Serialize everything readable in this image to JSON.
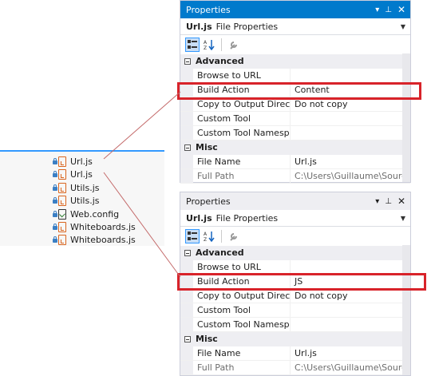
{
  "solution": {
    "items": [
      {
        "label": "Url.js",
        "icon": "js-file-icon"
      },
      {
        "label": "Url.js",
        "icon": "js-file-icon"
      },
      {
        "label": "Utils.js",
        "icon": "js-file-icon"
      },
      {
        "label": "Utils.js",
        "icon": "js-file-icon"
      },
      {
        "label": "Web.config",
        "icon": "config-file-icon"
      },
      {
        "label": "Whiteboards.js",
        "icon": "js-file-icon"
      },
      {
        "label": "Whiteboards.js",
        "icon": "js-file-icon"
      }
    ]
  },
  "panels": [
    {
      "title": "Properties",
      "object_name": "Url.js",
      "object_type": "File Properties",
      "categories": [
        {
          "name": "Advanced",
          "rows": [
            {
              "name": "Browse to URL",
              "value": ""
            },
            {
              "name": "Build Action",
              "value": "Content"
            },
            {
              "name": "Copy to Output Director",
              "value": "Do not copy"
            },
            {
              "name": "Custom Tool",
              "value": ""
            },
            {
              "name": "Custom Tool Namespac",
              "value": ""
            }
          ]
        },
        {
          "name": "Misc",
          "rows": [
            {
              "name": "File Name",
              "value": "Url.js"
            },
            {
              "name": "Full Path",
              "value": "C:\\Users\\Guillaume\\Sources\\"
            }
          ]
        }
      ]
    },
    {
      "title": "Properties",
      "object_name": "Url.js",
      "object_type": "File Properties",
      "categories": [
        {
          "name": "Advanced",
          "rows": [
            {
              "name": "Browse to URL",
              "value": ""
            },
            {
              "name": "Build Action",
              "value": "JS"
            },
            {
              "name": "Copy to Output Director",
              "value": "Do not copy"
            },
            {
              "name": "Custom Tool",
              "value": ""
            },
            {
              "name": "Custom Tool Namespac",
              "value": ""
            }
          ]
        },
        {
          "name": "Misc",
          "rows": [
            {
              "name": "File Name",
              "value": "Url.js"
            },
            {
              "name": "Full Path",
              "value": "C:\\Users\\Guillaume\\Sources\\"
            }
          ]
        }
      ]
    }
  ],
  "colors": {
    "accent": "#007acc",
    "highlight": "#d8232a",
    "js_icon": "#d9651f"
  }
}
